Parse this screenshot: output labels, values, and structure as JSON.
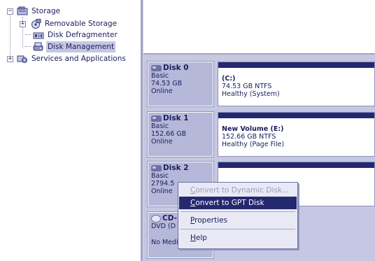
{
  "tree": {
    "items": [
      {
        "label": "Storage",
        "icon": "storage-icon",
        "expander": "−"
      },
      {
        "label": "Removable Storage",
        "icon": "removable-storage-icon",
        "expander": "+"
      },
      {
        "label": "Disk Defragmenter",
        "icon": "defragmenter-icon"
      },
      {
        "label": "Disk Management",
        "icon": "disk-management-icon",
        "selected": true
      },
      {
        "label": "Services and Applications",
        "icon": "services-icon",
        "expander": "+"
      }
    ]
  },
  "disks": [
    {
      "name": "Disk 0",
      "type": "Basic",
      "size": "74.53 GB",
      "status": "Online",
      "partition": {
        "name": "(C:)",
        "size": "74.53 GB NTFS",
        "status": "Healthy (System)"
      }
    },
    {
      "name": "Disk 1",
      "type": "Basic",
      "size": "152.66 GB",
      "status": "Online",
      "partition": {
        "name": "New Volume  (E:)",
        "size": "152.66 GB NTFS",
        "status": "Healthy (Page File)"
      }
    },
    {
      "name": "Disk 2",
      "type": "Basic",
      "size": "2794.5",
      "status": "Online"
    },
    {
      "name": "CD-",
      "type": "DVD (D",
      "status": "No Media"
    }
  ],
  "context_menu": {
    "items": [
      {
        "label": "Convert to Dynamic Disk...",
        "accel": "C",
        "rest": "onvert to Dynamic Disk...",
        "disabled": true
      },
      {
        "label": "Convert to GPT Disk",
        "accel": "C",
        "rest": "onvert to GPT Disk",
        "highlighted": true
      },
      {
        "label": "Properties",
        "accel": "P",
        "rest": "roperties"
      },
      {
        "label": "Help",
        "accel": "H",
        "rest": "elp"
      }
    ]
  },
  "colors": {
    "accent": "#23286f",
    "pane_bg": "#c6c7e2",
    "text": "#1a1d5c"
  }
}
